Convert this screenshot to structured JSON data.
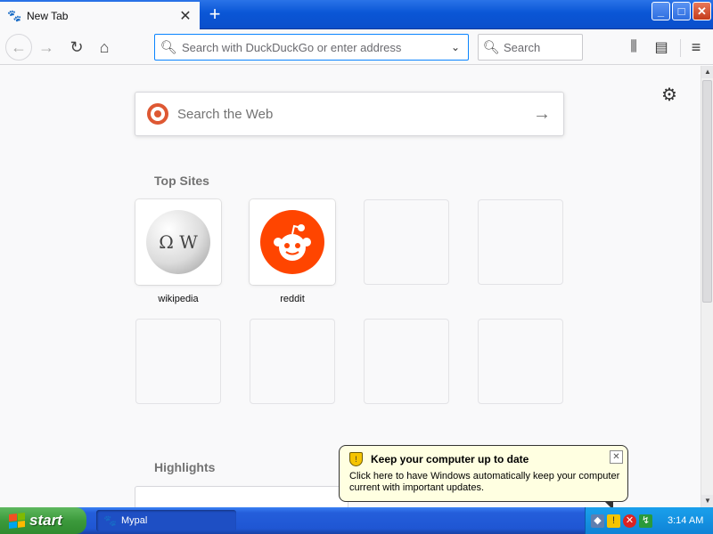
{
  "browser": {
    "tab": {
      "title": "New Tab",
      "close_glyph": "✕"
    },
    "new_tab_glyph": "+",
    "window_buttons": {
      "minimize": "_",
      "maximize": "□",
      "close": "✕"
    },
    "toolbar": {
      "back_glyph": "←",
      "forward_glyph": "→",
      "reload_glyph": "↻",
      "home_glyph": "⌂",
      "url_placeholder": "Search with DuckDuckGo or enter address",
      "url_dropdown_glyph": "⌄",
      "search_placeholder": "Search",
      "library_glyph": "⫼",
      "sidebar_glyph": "▤",
      "menu_glyph": "≡"
    }
  },
  "newtab": {
    "settings_glyph": "⚙",
    "web_search": {
      "placeholder": "Search the Web",
      "go_glyph": "→"
    },
    "top_sites": {
      "title": "Top Sites",
      "tiles": [
        {
          "label": "wikipedia",
          "icon": "wikipedia-icon",
          "glyph": "Ω W"
        },
        {
          "label": "reddit",
          "icon": "reddit-icon",
          "glyph": ""
        }
      ]
    },
    "highlights": {
      "title": "Highlights"
    }
  },
  "balloon": {
    "title": "Keep your computer up to date",
    "body": "Click here to have Windows automatically keep your computer current with important updates.",
    "close_glyph": "✕"
  },
  "taskbar": {
    "start_label": "start",
    "window_item": "Mypal",
    "clock": "3:14 AM"
  },
  "colors": {
    "xp_blue": "#245edb",
    "start_green": "#3c9a3c",
    "reddit_orange": "#ff4500",
    "ddg_orange": "#de5833",
    "balloon_yellow": "#ffffe1",
    "focus_blue": "#0a84ff"
  }
}
